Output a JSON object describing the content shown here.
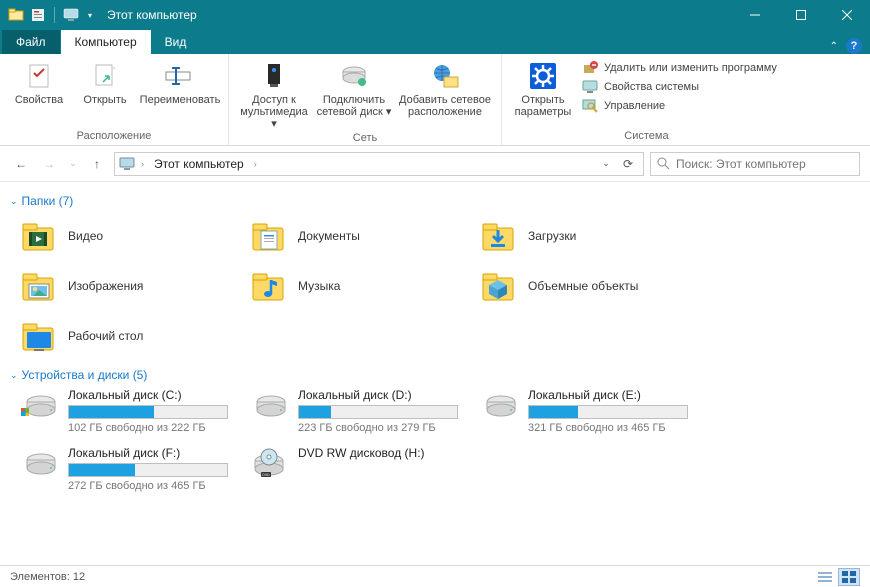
{
  "window": {
    "title": "Этот компьютер"
  },
  "tabs": {
    "file": "Файл",
    "computer": "Компьютер",
    "view": "Вид"
  },
  "ribbon": {
    "location": {
      "properties": "Свойства",
      "open": "Открыть",
      "rename": "Переименовать",
      "group": "Расположение"
    },
    "network": {
      "media": "Доступ к мультимедиа ▾",
      "mapdrive": "Подключить сетевой диск ▾",
      "addlocation": "Добавить сетевое расположение",
      "group": "Сеть"
    },
    "system": {
      "settings": "Открыть параметры",
      "uninstall": "Удалить или изменить программу",
      "sysprops": "Свойства системы",
      "manage": "Управление",
      "group": "Система"
    }
  },
  "nav": {
    "breadcrumb": "Этот компьютер",
    "search_placeholder": "Поиск: Этот компьютер"
  },
  "sections": {
    "folders_title": "Папки (7)",
    "drives_title": "Устройства и диски (5)"
  },
  "folders": [
    {
      "name": "Видео",
      "icon": "video"
    },
    {
      "name": "Документы",
      "icon": "documents"
    },
    {
      "name": "Загрузки",
      "icon": "downloads"
    },
    {
      "name": "Изображения",
      "icon": "pictures"
    },
    {
      "name": "Музыка",
      "icon": "music"
    },
    {
      "name": "Объемные объекты",
      "icon": "3d"
    },
    {
      "name": "Рабочий стол",
      "icon": "desktop"
    }
  ],
  "drives": [
    {
      "name": "Локальный диск (C:)",
      "free": "102 ГБ свободно из 222 ГБ",
      "used_pct": 54,
      "type": "hdd",
      "os": true
    },
    {
      "name": "Локальный диск (D:)",
      "free": "223 ГБ свободно из 279 ГБ",
      "used_pct": 20,
      "type": "hdd"
    },
    {
      "name": "Локальный диск (E:)",
      "free": "321 ГБ свободно из 465 ГБ",
      "used_pct": 31,
      "type": "hdd"
    },
    {
      "name": "Локальный диск (F:)",
      "free": "272 ГБ свободно из 465 ГБ",
      "used_pct": 42,
      "type": "hdd"
    },
    {
      "name": "DVD RW дисковод (H:)",
      "free": "",
      "used_pct": null,
      "type": "dvd"
    }
  ],
  "status": {
    "count": "Элементов: 12"
  }
}
